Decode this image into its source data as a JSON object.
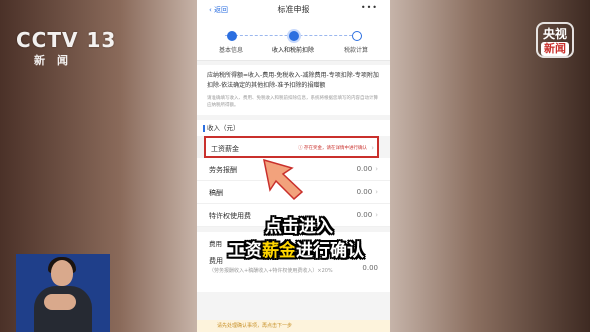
{
  "nav": {
    "back": "返回",
    "title": "标准申报",
    "more": "•••"
  },
  "steps": [
    {
      "label": "基本信息",
      "state": "done"
    },
    {
      "label": "收入和税前扣除",
      "state": "current"
    },
    {
      "label": "税款计算",
      "state": "todo"
    }
  ],
  "formula": "应纳税所得额=收入-费用-免税收入-减除费用-专项扣除-专项附加扣除-依法确定的其他扣除-准予扣除的捐赠额",
  "hint": "请准确填写收入、费用、免税收入和税前扣除信息，系统将根据您填写的内容自动计算应纳税所得额。",
  "income": {
    "title": "收入（元）",
    "salary": {
      "name": "工资薪金",
      "note": "存在奖金，请在详情中进行确认"
    },
    "rows": [
      {
        "name": "劳务报酬",
        "value": "0.00"
      },
      {
        "name": "稿酬",
        "value": "0.00"
      },
      {
        "name": "特许权使用费",
        "value": "0.00"
      }
    ]
  },
  "cost": {
    "head": "费用",
    "name": "费用",
    "sub": "（劳务报酬收入+稿酬收入+特许权使用费收入）×20%",
    "value": "0.00"
  },
  "notice": "请先处理确认事项，再点击下一步",
  "caption": {
    "line1": "点击进入",
    "line2_pre": "工资",
    "line2_hl": "薪金",
    "line2_post": "进行确认"
  },
  "logos": {
    "left_top": "CCTV 13",
    "left_bottom": "新闻",
    "right_top": "央视",
    "right_bottom": "新闻"
  },
  "colors": {
    "accent": "#2c6fe0",
    "highlight": "#c9302c",
    "caption_hl": "#ffd600"
  }
}
